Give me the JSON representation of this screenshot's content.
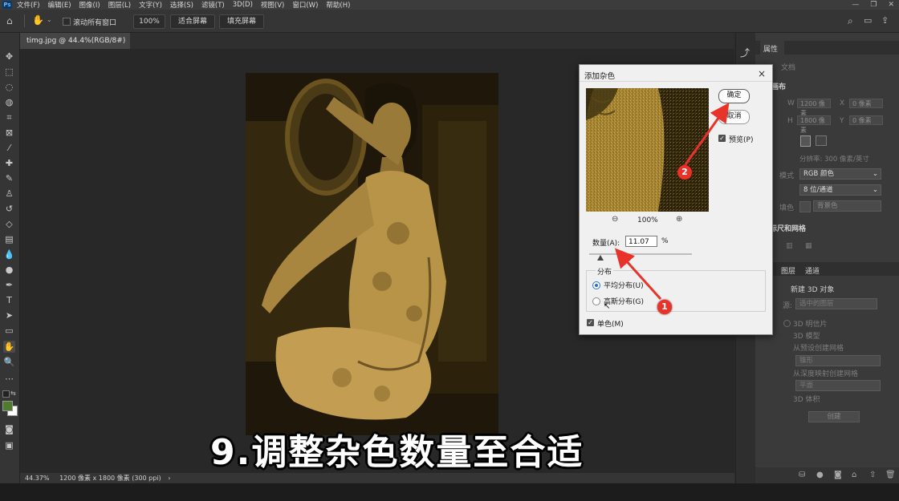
{
  "menubar": {
    "app_badge": "Ps",
    "items": [
      "文件(F)",
      "编辑(E)",
      "图像(I)",
      "图层(L)",
      "文字(Y)",
      "选择(S)",
      "滤镜(T)",
      "3D(D)",
      "视图(V)",
      "窗口(W)",
      "帮助(H)"
    ]
  },
  "options": {
    "scroll_all_label": "滚动所有窗口",
    "zoom_value": "100%",
    "fit_screen_label": "适合屏幕",
    "fill_screen_label": "填充屏幕"
  },
  "document": {
    "tab_title": "timg.jpg @ 44.4%(RGB/8#) *",
    "tab_close": "×",
    "status_zoom": "44.37%",
    "status_info": "1200 像素 x 1800 像素 (300 ppi)",
    "status_arrow": "›"
  },
  "dialog": {
    "title": "添加杂色",
    "close": "×",
    "ok_label": "确定",
    "cancel_label": "取消",
    "preview_label": "预览(P)",
    "zoom_out": "⊖",
    "zoom_value": "100%",
    "zoom_in": "⊕",
    "amount_label": "数量(A):",
    "amount_value": "11.07",
    "amount_unit": "%",
    "amount_slider_fraction": 0.11,
    "distribution_label": "分布",
    "uniform_label": "平均分布(U)",
    "gaussian_label": "高斯分布(G)",
    "mono_label": "单色(M)"
  },
  "panel": {
    "tab_properties": "属性",
    "doc_label": "文档",
    "canvas_header": "画布",
    "w_label": "W",
    "w_value": "1200 像素",
    "h_label": "H",
    "h_value": "1800 像素",
    "x_label": "X",
    "x_value": "0 像素",
    "y_label": "Y",
    "y_value": "0 像素",
    "resolution": "分辨率: 300 像素/英寸",
    "mode_label": "模式",
    "mode_value": "RGB 颜色",
    "depth_value": "8 位/通道",
    "fill_label": "填色",
    "fill_value": "背景色",
    "rulers_header": "标尺和网格",
    "tab_layers": "图层",
    "tab_channels": "通道",
    "new3d_header": "新建 3D 对象",
    "source_label": "源:",
    "source_value": "选中的图层",
    "opt_postcard": "3D 明信片",
    "opt_model": "3D 模型",
    "opt_preset_mesh": "从预设创建网格",
    "preset_value": "锥形",
    "opt_depth_mesh": "从深度映射创建网格",
    "depth_value2": "平面",
    "opt_volume": "3D 体积",
    "create_label": "创建"
  },
  "annotations": {
    "badge1": "1",
    "badge2": "2",
    "caption": "9.调整杂色数量至合适"
  }
}
